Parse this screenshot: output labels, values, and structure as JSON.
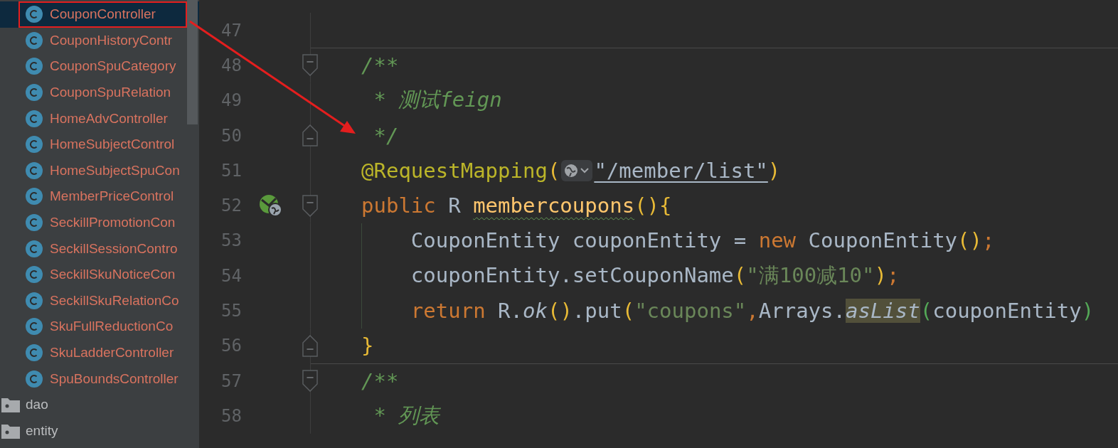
{
  "sidebar": {
    "items": [
      {
        "kind": "class",
        "label": "CouponController",
        "selected": true,
        "highlighted": true
      },
      {
        "kind": "class",
        "label": "CouponHistoryContr",
        "selected": false,
        "highlighted": false
      },
      {
        "kind": "class",
        "label": "CouponSpuCategory",
        "selected": false,
        "highlighted": false
      },
      {
        "kind": "class",
        "label": "CouponSpuRelation",
        "selected": false,
        "highlighted": false
      },
      {
        "kind": "class",
        "label": "HomeAdvController",
        "selected": false,
        "highlighted": false
      },
      {
        "kind": "class",
        "label": "HomeSubjectControl",
        "selected": false,
        "highlighted": false
      },
      {
        "kind": "class",
        "label": "HomeSubjectSpuCon",
        "selected": false,
        "highlighted": false
      },
      {
        "kind": "class",
        "label": "MemberPriceControl",
        "selected": false,
        "highlighted": false
      },
      {
        "kind": "class",
        "label": "SeckillPromotionCon",
        "selected": false,
        "highlighted": false
      },
      {
        "kind": "class",
        "label": "SeckillSessionContro",
        "selected": false,
        "highlighted": false
      },
      {
        "kind": "class",
        "label": "SeckillSkuNoticeCon",
        "selected": false,
        "highlighted": false
      },
      {
        "kind": "class",
        "label": "SeckillSkuRelationCo",
        "selected": false,
        "highlighted": false
      },
      {
        "kind": "class",
        "label": "SkuFullReductionCo",
        "selected": false,
        "highlighted": false
      },
      {
        "kind": "class",
        "label": "SkuLadderController",
        "selected": false,
        "highlighted": false
      },
      {
        "kind": "class",
        "label": "SpuBoundsController",
        "selected": false,
        "highlighted": false
      },
      {
        "kind": "folder",
        "label": "dao",
        "selected": false,
        "highlighted": false
      },
      {
        "kind": "folder",
        "label": "entity",
        "selected": false,
        "highlighted": false
      }
    ]
  },
  "arrow": true,
  "editor": {
    "lines": [
      {
        "number": "47"
      },
      {
        "number": "48",
        "separator_above": true,
        "fold_start": true,
        "tokens": [
          {
            "kind": "comment",
            "text": "/**"
          }
        ]
      },
      {
        "number": "49",
        "tokens": [
          {
            "kind": "comment",
            "text": " * 测试feign"
          }
        ]
      },
      {
        "number": "50",
        "fold_end": true,
        "tokens": [
          {
            "kind": "comment",
            "text": " */"
          }
        ]
      },
      {
        "number": "51",
        "tokens": [
          {
            "kind": "annotation",
            "text": "@RequestMapping"
          },
          {
            "kind": "brace",
            "text": "("
          },
          {
            "kind": "inlay"
          },
          {
            "kind": "url",
            "text": "\"/member/list\""
          },
          {
            "kind": "brace",
            "text": ")"
          }
        ]
      },
      {
        "number": "52",
        "gutter_icon": true,
        "fold_start": true,
        "tokens": [
          {
            "kind": "keyword",
            "text": "public"
          },
          {
            "kind": "plain",
            "text": " R "
          },
          {
            "kind": "func-warn",
            "text": "membercoupons"
          },
          {
            "kind": "brace",
            "text": "(){"
          }
        ]
      },
      {
        "number": "53",
        "indent_guide": true,
        "tokens": [
          {
            "kind": "plain",
            "text": "    CouponEntity couponEntity = "
          },
          {
            "kind": "keyword",
            "text": "new"
          },
          {
            "kind": "plain",
            "text": " CouponEntity"
          },
          {
            "kind": "brace",
            "text": "()"
          },
          {
            "kind": "punct",
            "text": ";"
          }
        ]
      },
      {
        "number": "54",
        "indent_guide": true,
        "tokens": [
          {
            "kind": "plain",
            "text": "    couponEntity.setCouponName"
          },
          {
            "kind": "brace",
            "text": "("
          },
          {
            "kind": "string",
            "text": "\"满100减10\""
          },
          {
            "kind": "brace",
            "text": ")"
          },
          {
            "kind": "punct",
            "text": ";"
          }
        ]
      },
      {
        "number": "55",
        "indent_guide": true,
        "tokens": [
          {
            "kind": "keyword",
            "text": "    return"
          },
          {
            "kind": "plain",
            "text": " R."
          },
          {
            "kind": "italic",
            "text": "ok"
          },
          {
            "kind": "brace",
            "text": "()"
          },
          {
            "kind": "plain",
            "text": ".put"
          },
          {
            "kind": "brace",
            "text": "("
          },
          {
            "kind": "string",
            "text": "\"coupons\""
          },
          {
            "kind": "punct",
            "text": ","
          },
          {
            "kind": "plain",
            "text": "Arrays."
          },
          {
            "kind": "italic-hl",
            "text": "asList"
          },
          {
            "kind": "brace2",
            "text": "("
          },
          {
            "kind": "plain",
            "text": "couponEntity"
          },
          {
            "kind": "brace2",
            "text": ")"
          }
        ]
      },
      {
        "number": "56",
        "fold_end": true,
        "tokens": [
          {
            "kind": "brace",
            "text": "}"
          }
        ]
      },
      {
        "number": "57",
        "separator_above": true,
        "fold_start": true,
        "tokens": [
          {
            "kind": "comment",
            "text": "/**"
          }
        ]
      },
      {
        "number": "58",
        "tokens": [
          {
            "kind": "comment",
            "text": " * 列表"
          }
        ]
      }
    ]
  }
}
